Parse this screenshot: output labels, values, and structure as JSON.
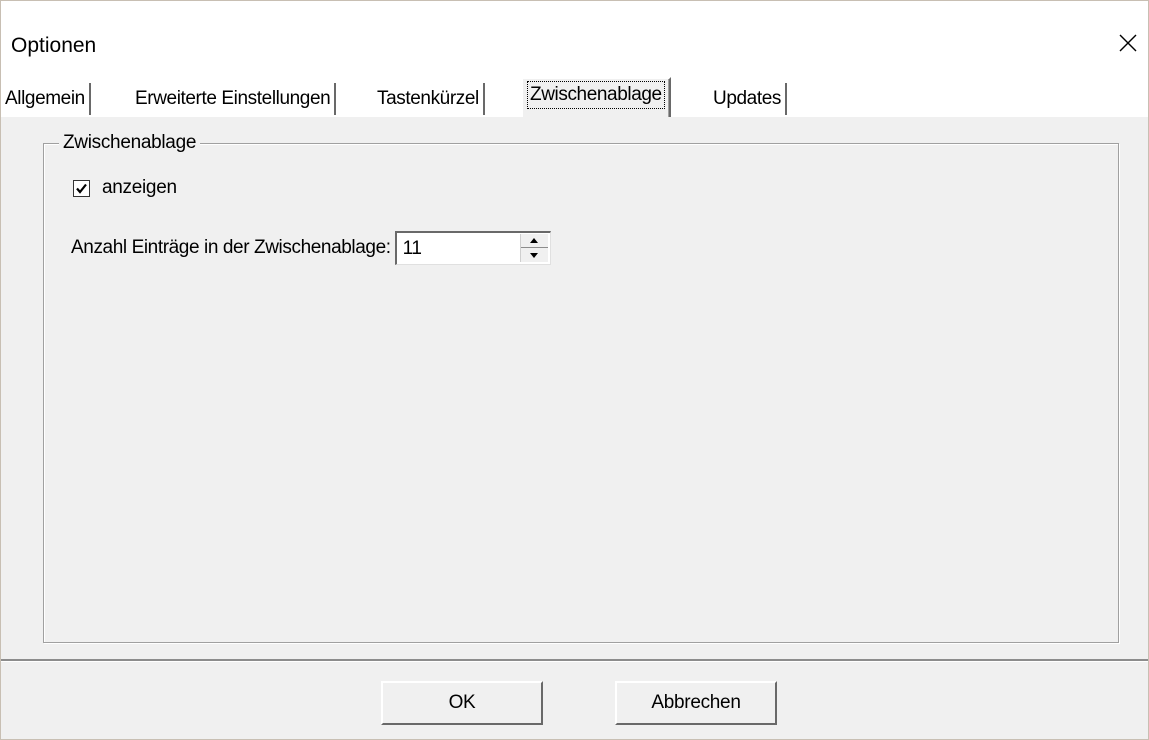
{
  "window": {
    "title": "Optionen"
  },
  "tabs": [
    {
      "label": "Allgemein",
      "active": false
    },
    {
      "label": "Erweiterte Einstellungen",
      "active": false
    },
    {
      "label": "Tastenkürzel",
      "active": false
    },
    {
      "label": "Zwischenablage",
      "active": true
    },
    {
      "label": "Updates",
      "active": false
    }
  ],
  "group": {
    "legend": "Zwischenablage",
    "show_checkbox": {
      "label": "anzeigen",
      "checked": true
    },
    "entries": {
      "label": "Anzahl Einträge in der Zwischenablage:",
      "value": "11"
    }
  },
  "footer": {
    "ok_label": "OK",
    "cancel_label": "Abbrechen"
  },
  "icons": {
    "close": "close-icon",
    "check": "check-icon",
    "spin_up": "spin-up-icon",
    "spin_down": "spin-down-icon"
  }
}
